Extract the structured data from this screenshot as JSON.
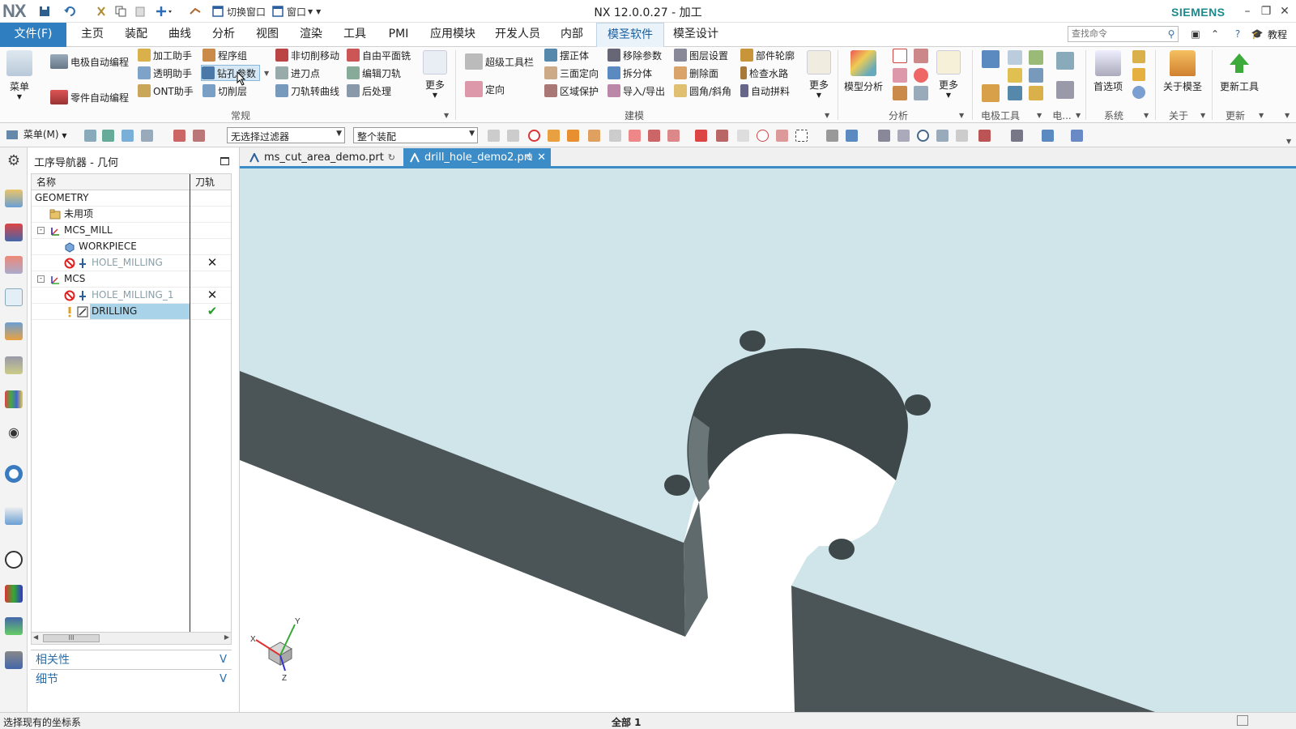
{
  "titlebar": {
    "logo": "NX",
    "switch_window": "切换窗口",
    "window_menu": "窗口",
    "title": "NX 12.0.0.27 - 加工",
    "brand": "SIEMENS"
  },
  "menubar": {
    "file": "文件(F)",
    "tabs": [
      "主页",
      "装配",
      "曲线",
      "分析",
      "视图",
      "渲染",
      "工具",
      "PMI",
      "应用模块",
      "开发人员",
      "内部",
      "模圣软件",
      "模圣设计"
    ],
    "active_tab": "模圣软件",
    "search_placeholder": "查找命令",
    "tutorial": "教程"
  },
  "ribbon": {
    "menu_label": "菜单",
    "col1": [
      "电极自动编程",
      "零件自动编程"
    ],
    "col2": [
      "加工助手",
      "透明助手",
      "ONT助手"
    ],
    "col3": [
      "程序组",
      "钻孔参数",
      "切削层"
    ],
    "col4": [
      "非切削移动",
      "进刀点",
      "刀轨转曲线"
    ],
    "col5": [
      "自由平面铣",
      "编辑刀轨",
      "后处理"
    ],
    "more1": "更多",
    "group_general": "常规",
    "col6": [
      "超级工具栏",
      "定向"
    ],
    "col7": [
      "摆正体",
      "三面定向",
      "区域保护"
    ],
    "col8": [
      "移除参数",
      "拆分体",
      "导入/导出"
    ],
    "col9": [
      "图层设置",
      "删除面",
      "圆角/斜角"
    ],
    "col10": [
      "部件轮廓",
      "检查水路",
      "自动拼料"
    ],
    "more2": "更多",
    "group_modeling": "建模",
    "model_analysis": "模型分析",
    "more3": "更多",
    "group_analysis": "分析",
    "group_electrode": "电极工具",
    "group_elec_short": "电...",
    "preferences": "首选项",
    "group_system": "系统",
    "about": "关于模圣",
    "group_about": "关于",
    "update_tool": "更新工具",
    "group_update": "更新"
  },
  "toolbar2": {
    "menu": "菜单(M)",
    "filter": "无选择过滤器",
    "assembly": "整个装配"
  },
  "navigator": {
    "title": "工序导航器 - 几何",
    "col_name": "名称",
    "col_path": "刀轨",
    "rows": [
      {
        "label": "GEOMETRY",
        "indent": 0,
        "icon": "none",
        "path": "",
        "grey": false
      },
      {
        "label": "未用项",
        "indent": 1,
        "icon": "folder",
        "path": "",
        "grey": false
      },
      {
        "label": "MCS_MILL",
        "indent": 1,
        "icon": "mcs",
        "path": "",
        "grey": false,
        "expand": "-"
      },
      {
        "label": "WORKPIECE",
        "indent": 2,
        "icon": "workpiece",
        "path": "",
        "grey": false
      },
      {
        "label": "HOLE_MILLING",
        "indent": 2,
        "icon": "blocked",
        "path": "✕",
        "grey": true
      },
      {
        "label": "MCS",
        "indent": 1,
        "icon": "mcs",
        "path": "",
        "grey": false,
        "expand": "-"
      },
      {
        "label": "HOLE_MILLING_1",
        "indent": 2,
        "icon": "blocked",
        "path": "✕",
        "grey": true
      },
      {
        "label": "DRILLING",
        "indent": 2,
        "icon": "drill",
        "path": "✔",
        "grey": false,
        "selected": true
      }
    ],
    "scroll_thumb": "III",
    "dependencies": "相关性",
    "details": "细节"
  },
  "doctabs": [
    {
      "label": "ms_cut_area_demo.prt",
      "active": false
    },
    {
      "label": "drill_hole_demo2.prt",
      "active": true
    }
  ],
  "viewport": {
    "axis_x": "X",
    "axis_y": "Y",
    "axis_z": "Z"
  },
  "statusbar": {
    "message": "选择现有的坐标系",
    "center": "全部 1"
  },
  "colors": {
    "accent": "#3b8cc7",
    "file_menu": "#2f7fc0",
    "viewport_bg": "#cfe5ea",
    "part_dark": "#4b5557",
    "selected_row": "#a9d3e8",
    "brand": "#1a8a8f"
  }
}
